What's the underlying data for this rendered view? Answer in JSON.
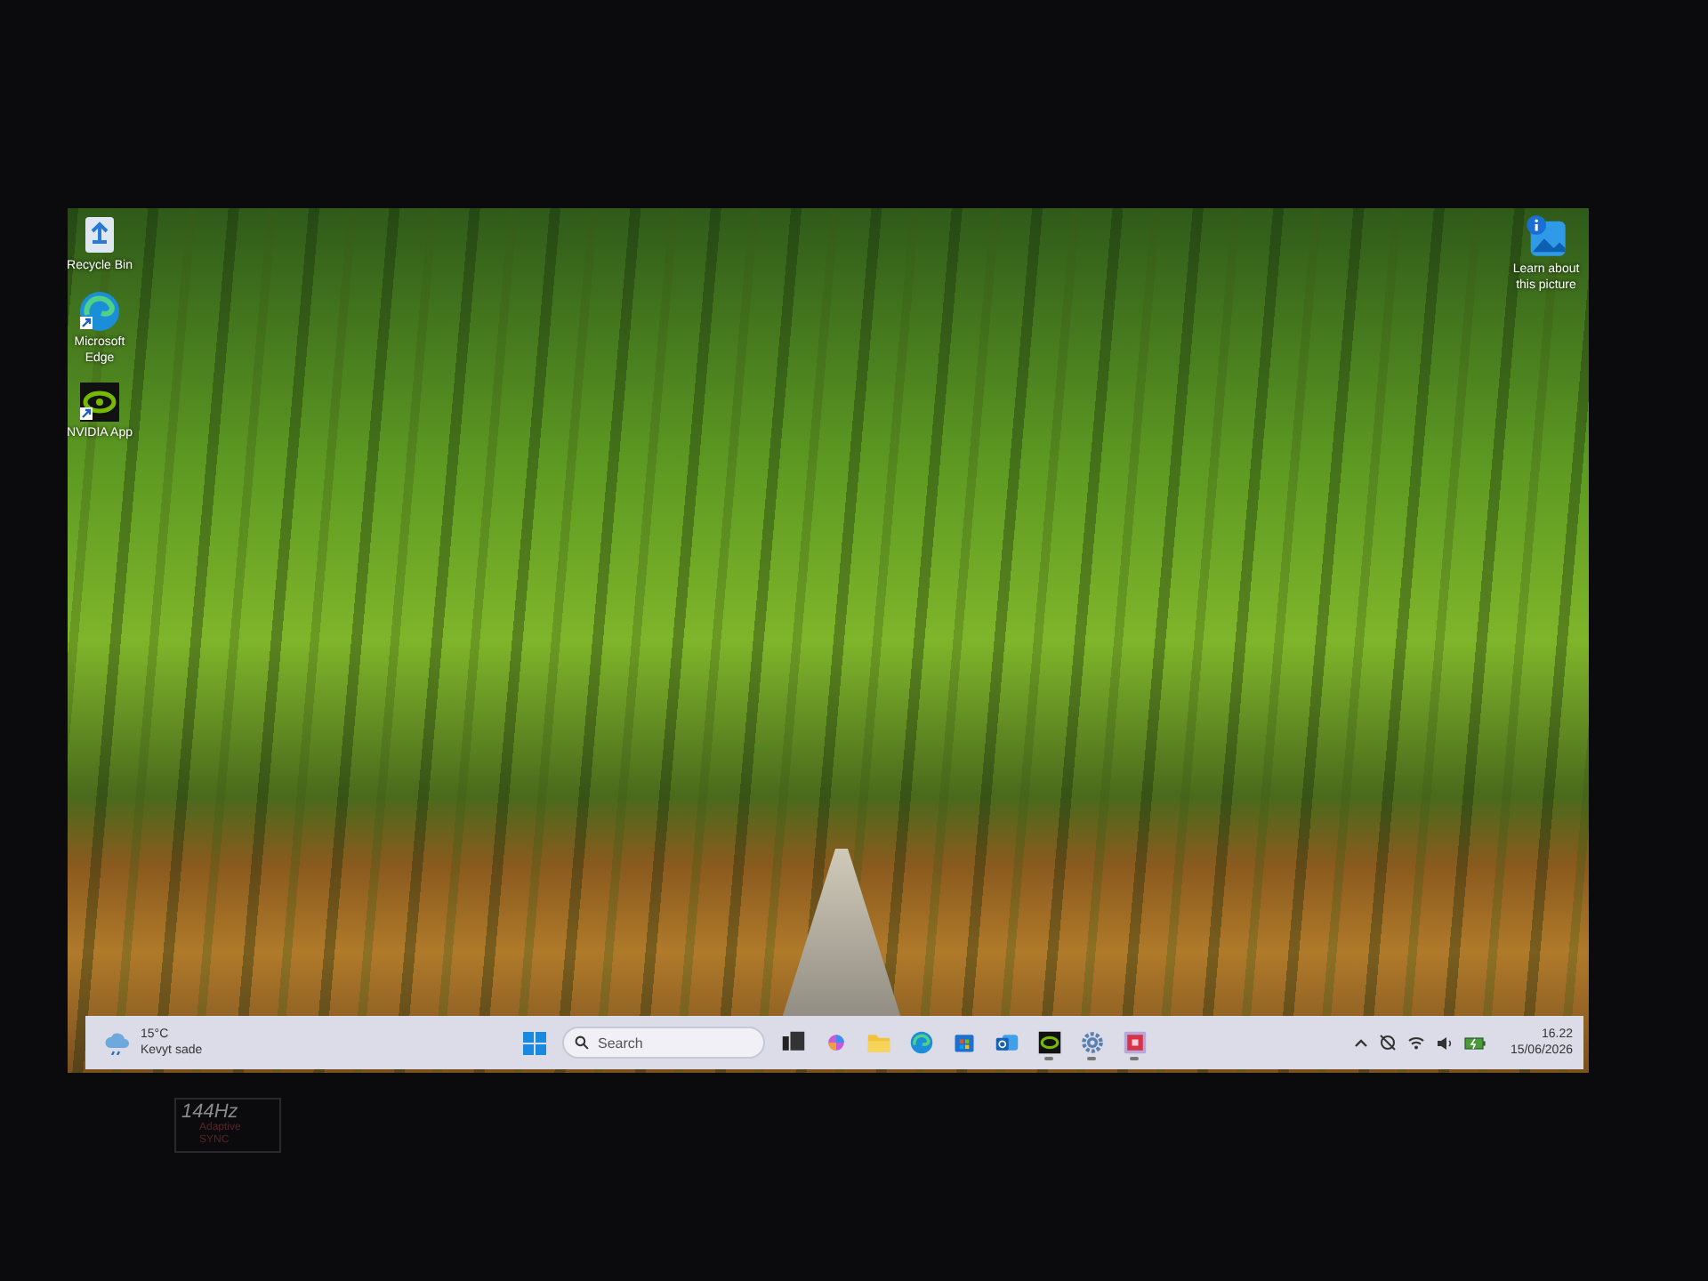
{
  "desktop": {
    "icons": [
      {
        "kind": "recycle",
        "label": "Recycle Bin",
        "shortcut": false
      },
      {
        "kind": "edge",
        "label": "Microsoft Edge",
        "shortcut": true
      },
      {
        "kind": "nvidia",
        "label": "NVIDIA App",
        "shortcut": true
      }
    ],
    "corner_icon": {
      "label": "Learn about this picture"
    }
  },
  "taskbar": {
    "weather": {
      "temperature": "15°C",
      "condition": "Kevyt sade"
    },
    "search": {
      "placeholder": "Search"
    },
    "apps": [
      {
        "kind": "taskview",
        "running": false
      },
      {
        "kind": "copilot",
        "running": false
      },
      {
        "kind": "explorer",
        "running": false
      },
      {
        "kind": "edge",
        "running": false
      },
      {
        "kind": "store",
        "running": false
      },
      {
        "kind": "outlook",
        "running": false
      },
      {
        "kind": "nvidia",
        "running": true
      },
      {
        "kind": "settings",
        "running": true
      },
      {
        "kind": "app",
        "running": true
      }
    ],
    "tray": {
      "time": "16.22",
      "date": "15/06/2026"
    }
  },
  "bezel": {
    "sticker": [
      "144Hz",
      "Adaptive",
      "SYNC"
    ]
  }
}
